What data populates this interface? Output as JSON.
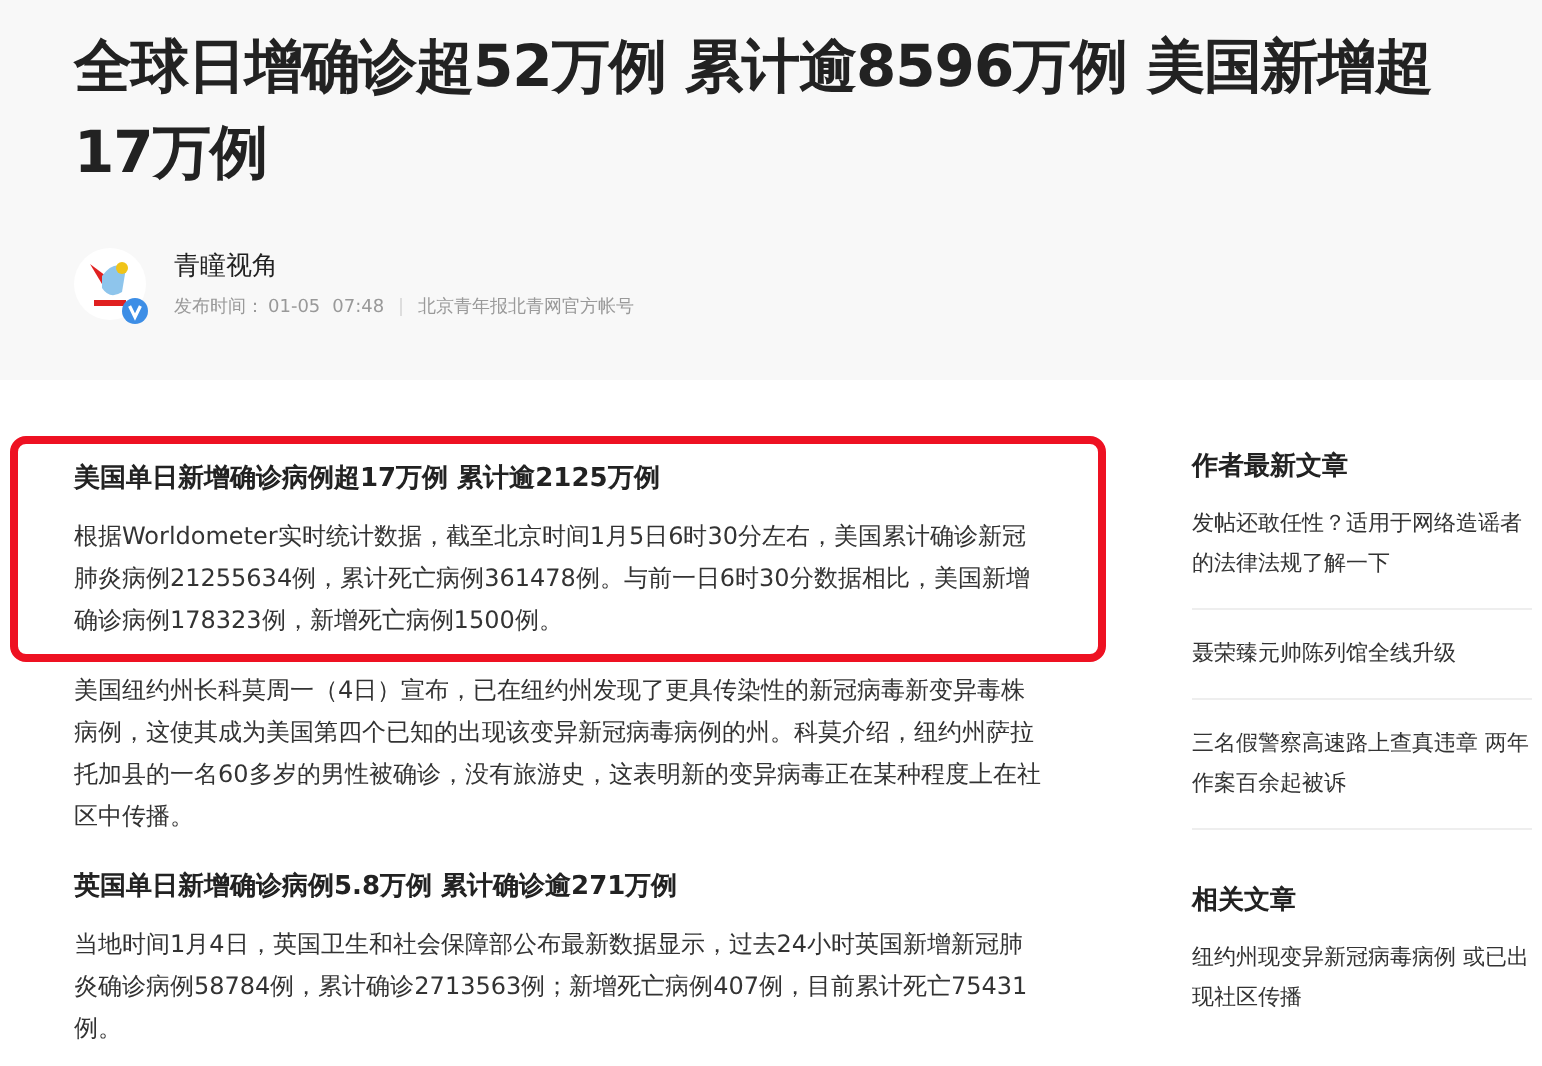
{
  "header": {
    "title": "全球日增确诊超52万例 累计逾8596万例 美国新增超17万例",
    "author": {
      "name": "青瞳视角",
      "verified": true,
      "publish_label": "发布时间：",
      "date": "01-05",
      "time": "07:48",
      "source": "北京青年报北青网官方帐号"
    }
  },
  "article": {
    "blocks": [
      {
        "kind": "heading",
        "highlighted": true,
        "text": "美国单日新增确诊病例超17万例 累计逾2125万例"
      },
      {
        "kind": "paragraph",
        "highlighted": true,
        "text": "根据Worldometer实时统计数据，截至北京时间1月5日6时30分左右，美国累计确诊新冠肺炎病例21255634例，累计死亡病例361478例。与前一日6时30分数据相比，美国新增确诊病例178323例，新增死亡病例1500例。"
      },
      {
        "kind": "paragraph",
        "highlighted": false,
        "text": "美国纽约州长科莫周一（4日）宣布，已在纽约州发现了更具传染性的新冠病毒新变异毒株病例，这使其成为美国第四个已知的出现该变异新冠病毒病例的州。科莫介绍，纽约州萨拉托加县的一名60多岁的男性被确诊，没有旅游史，这表明新的变异病毒正在某种程度上在社区中传播。"
      },
      {
        "kind": "heading",
        "highlighted": false,
        "text": "英国单日新增确诊病例5.8万例 累计确诊逾271万例"
      },
      {
        "kind": "paragraph",
        "highlighted": false,
        "text": "当地时间1月4日，英国卫生和社会保障部公布最新数据显示，过去24小时英国新增新冠肺炎确诊病例58784例，累计确诊2713563例；新增死亡病例407例，目前累计死亡75431例。"
      }
    ]
  },
  "sidebar": {
    "sections": [
      {
        "title": "作者最新文章",
        "items": [
          "发帖还敢任性？适用于网络造谣者的法律法规了解一下",
          "聂荣臻元帅陈列馆全线升级",
          "三名假警察高速路上查真违章 两年作案百余起被诉"
        ]
      },
      {
        "title": "相关文章",
        "items": [
          "纽约州现变异新冠病毒病例 或已出现社区传播"
        ]
      }
    ]
  }
}
